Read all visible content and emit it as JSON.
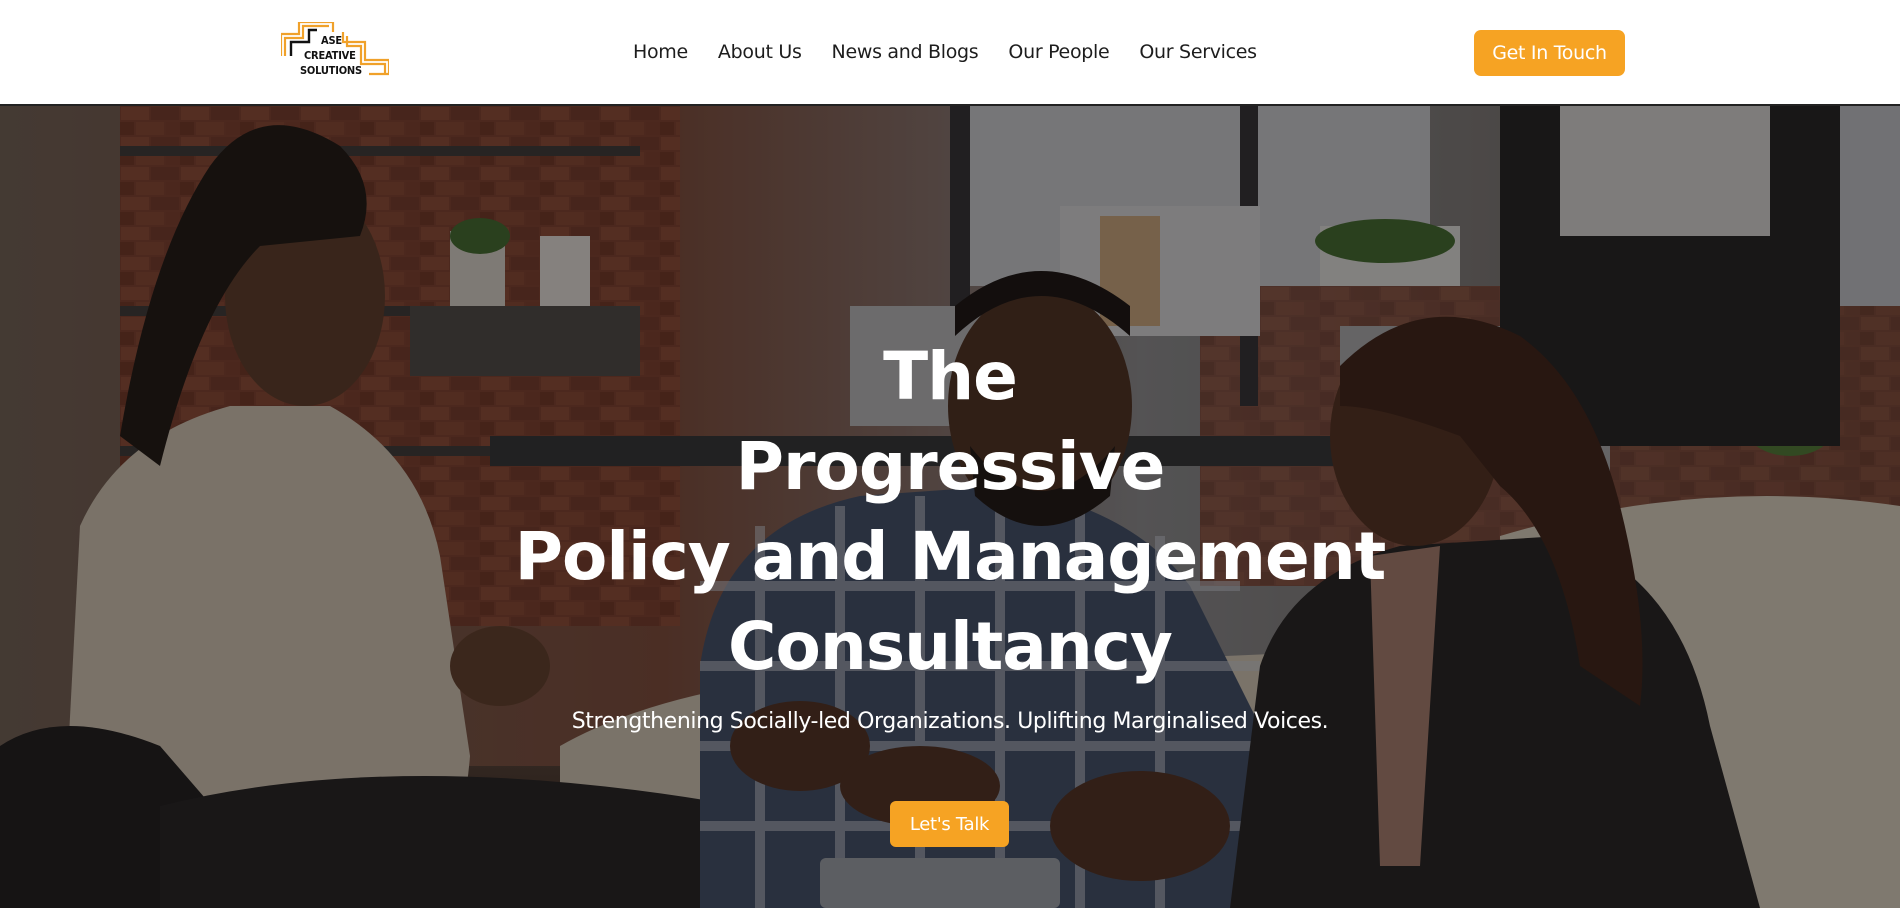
{
  "brand": {
    "logo_lines": [
      "ASE",
      "CREATIVE",
      "SOLUTIONS"
    ],
    "accent_color": "#f6a323"
  },
  "nav": {
    "items": [
      {
        "label": "Home"
      },
      {
        "label": "About Us"
      },
      {
        "label": "News and Blogs"
      },
      {
        "label": "Our People"
      },
      {
        "label": "Our Services"
      }
    ]
  },
  "header": {
    "cta_label": "Get In Touch"
  },
  "hero": {
    "title_lines": [
      "The",
      "Progressive",
      "Policy and Management",
      "Consultancy"
    ],
    "subtitle": "Strengthening Socially-led Organizations. Uplifting Marginalised Voices.",
    "cta_label": "Let's Talk",
    "background_description_icon": "office-meeting-photo"
  }
}
